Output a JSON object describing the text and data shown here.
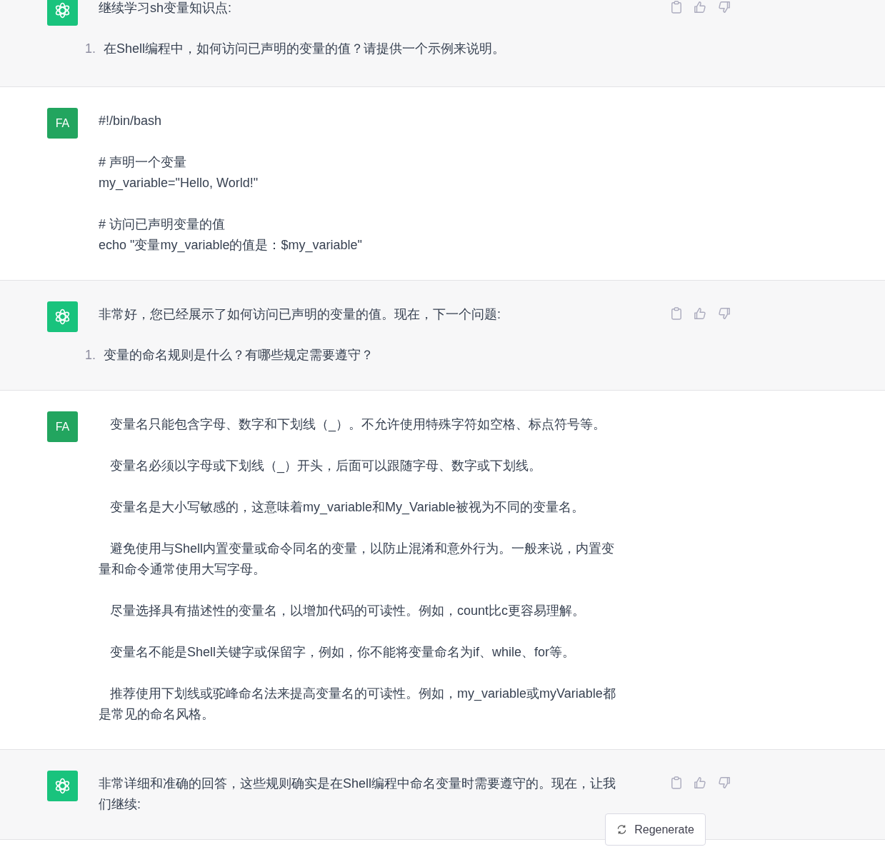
{
  "messages": [
    {
      "kind": "assistant",
      "paragraphs": [
        "继续学习sh变量知识点:"
      ],
      "list": [
        {
          "number": "1.",
          "text": "在Shell编程中，如何访问已声明的变量的值？请提供一个示例来说明。"
        }
      ]
    },
    {
      "kind": "user",
      "avatar": "FA",
      "blocks": [
        [
          "#!/bin/bash"
        ],
        [
          "# 声明一个变量",
          "my_variable=\"Hello, World!\""
        ],
        [
          "# 访问已声明变量的值",
          "echo \"变量my_variable的值是：$my_variable\""
        ]
      ]
    },
    {
      "kind": "assistant",
      "paragraphs": [
        "非常好，您已经展示了如何访问已声明的变量的值。现在，下一个问题:"
      ],
      "list": [
        {
          "number": "1.",
          "text": "变量的命名规则是什么？有哪些规定需要遵守？"
        }
      ]
    },
    {
      "kind": "user",
      "avatar": "FA",
      "indented": true,
      "blocks": [
        [
          "变量名只能包含字母、数字和下划线（_）。不允许使用特殊字符如空格、标点符号等。"
        ],
        [
          "变量名必须以字母或下划线（_）开头，后面可以跟随字母、数字或下划线。"
        ],
        [
          "变量名是大小写敏感的，这意味着my_variable和My_Variable被视为不同的变量名。"
        ],
        [
          "避免使用与Shell内置变量或命令同名的变量，以防止混淆和意外行为。一般来说，内置变量和命令通常使用大写字母。"
        ],
        [
          "尽量选择具有描述性的变量名，以增加代码的可读性。例如，count比c更容易理解。"
        ],
        [
          "变量名不能是Shell关键字或保留字，例如，你不能将变量命名为if、while、for等。"
        ],
        [
          "推荐使用下划线或驼峰命名法来提高变量名的可读性。例如，my_variable或myVariable都是常见的命名风格。"
        ]
      ]
    },
    {
      "kind": "assistant",
      "paragraphs": [
        "非常详细和准确的回答，这些规则确实是在Shell编程中命名变量时需要遵守的。现在，让我们继续:"
      ]
    }
  ],
  "regenerate_button": {
    "label": "Regenerate"
  }
}
